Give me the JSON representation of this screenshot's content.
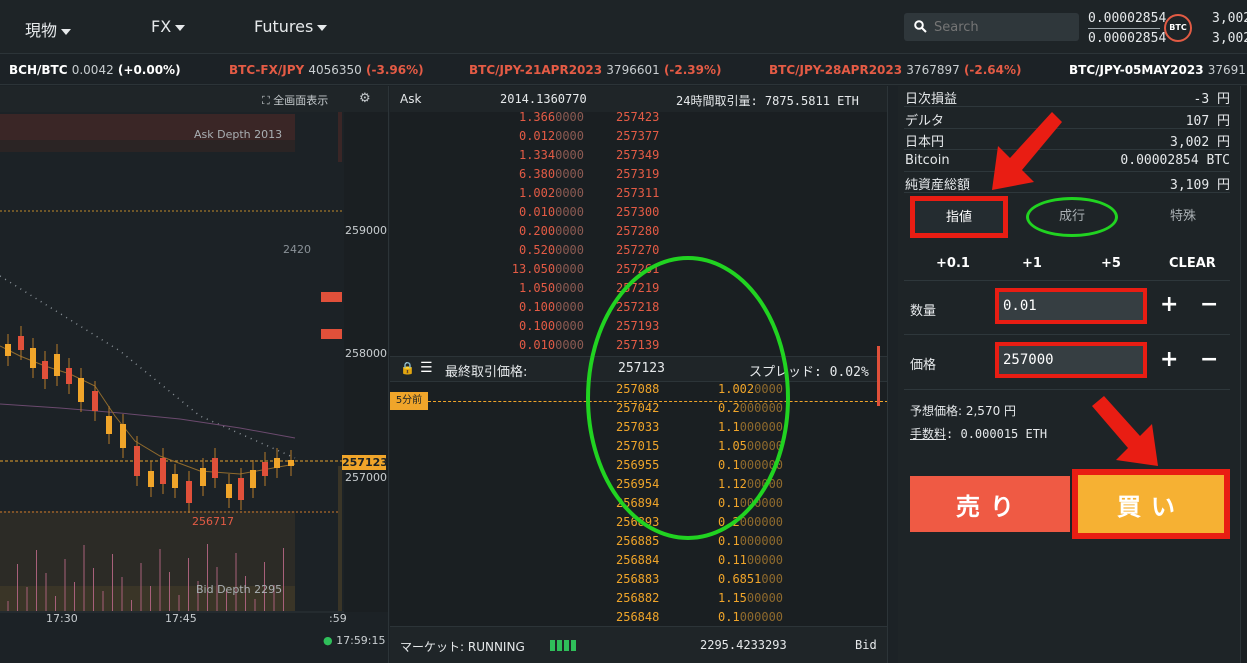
{
  "nav": {
    "items": [
      "現物",
      "FX",
      "Futures"
    ],
    "search_placeholder": "Search",
    "balance_top": "0.00002854",
    "balance_bottom": "0.00002854",
    "badge": "BTC",
    "right_top": "3,002",
    "right_bottom": "3,002"
  },
  "ticker": [
    {
      "symbol": "BCH/BTC",
      "price": "0.0042",
      "change": "(+0.00%)",
      "symbol_color": "white"
    },
    {
      "symbol": "BTC-FX/JPY",
      "price": "4056350",
      "change": "(-3.96%)",
      "symbol_color": "red"
    },
    {
      "symbol": "BTC/JPY-21APR2023",
      "price": "3796601",
      "change": "(-2.39%)",
      "symbol_color": "red"
    },
    {
      "symbol": "BTC/JPY-28APR2023",
      "price": "3767897",
      "change": "(-2.64%)",
      "symbol_color": "red"
    },
    {
      "symbol": "BTC/JPY-05MAY2023",
      "price": "37691",
      "change": "",
      "symbol_color": "white"
    }
  ],
  "chart": {
    "fullscreen_label": "全画面表示",
    "ask_depth_label": "Ask Depth 2013",
    "bid_depth_label": "Bid Depth 2295",
    "y_ticks": [
      "259000",
      "258000",
      "257000"
    ],
    "current_price": "257123",
    "low_label": "256717",
    "mid_label": "2420",
    "x_ticks": [
      "17:30",
      "17:45",
      ":59"
    ],
    "clock": "17:59:15"
  },
  "book": {
    "ask_label": "Ask",
    "ask_total": "2014.1360770",
    "volume_label": "24時間取引量: 7875.5811 ETH",
    "asks": [
      {
        "size_main": "1.366",
        "size_dim": "0000",
        "price": "257423"
      },
      {
        "size_main": "0.012",
        "size_dim": "0000",
        "price": "257377"
      },
      {
        "size_main": "1.334",
        "size_dim": "0000",
        "price": "257349"
      },
      {
        "size_main": "6.380",
        "size_dim": "0000",
        "price": "257319"
      },
      {
        "size_main": "1.002",
        "size_dim": "0000",
        "price": "257311"
      },
      {
        "size_main": "0.010",
        "size_dim": "0000",
        "price": "257300"
      },
      {
        "size_main": "0.200",
        "size_dim": "0000",
        "price": "257280"
      },
      {
        "size_main": "0.520",
        "size_dim": "0000",
        "price": "257270"
      },
      {
        "size_main": "13.050",
        "size_dim": "0000",
        "price": "257261"
      },
      {
        "size_main": "1.050",
        "size_dim": "0000",
        "price": "257219"
      },
      {
        "size_main": "0.100",
        "size_dim": "0000",
        "price": "257218"
      },
      {
        "size_main": "0.100",
        "size_dim": "0000",
        "price": "257193"
      },
      {
        "size_main": "0.010",
        "size_dim": "0000",
        "price": "257139"
      }
    ],
    "last_price_label": "最終取引価格:",
    "last_price": "257123",
    "spread_label": "スプレッド: 0.02%",
    "time_tag": "5分前",
    "bids": [
      {
        "price": "257088",
        "size_main": "1.002",
        "size_dim": "0000"
      },
      {
        "price": "257042",
        "size_main": "0.2",
        "size_dim": "000000"
      },
      {
        "price": "257033",
        "size_main": "1.1",
        "size_dim": "000000"
      },
      {
        "price": "257015",
        "size_main": "1.05",
        "size_dim": "00000"
      },
      {
        "price": "256955",
        "size_main": "0.1",
        "size_dim": "000000"
      },
      {
        "price": "256954",
        "size_main": "1.12",
        "size_dim": "00000"
      },
      {
        "price": "256894",
        "size_main": "0.1",
        "size_dim": "000000"
      },
      {
        "price": "256893",
        "size_main": "0.2",
        "size_dim": "000000"
      },
      {
        "price": "256885",
        "size_main": "0.1",
        "size_dim": "000000"
      },
      {
        "price": "256884",
        "size_main": "0.11",
        "size_dim": "00000"
      },
      {
        "price": "256883",
        "size_main": "0.6851",
        "size_dim": "000"
      },
      {
        "price": "256882",
        "size_main": "1.15",
        "size_dim": "00000"
      },
      {
        "price": "256848",
        "size_main": "0.1",
        "size_dim": "000000"
      }
    ],
    "market_label": "マーケット: RUNNING",
    "bid_total": "2295.4233293",
    "bid_label": "Bid"
  },
  "account": [
    {
      "label": "日次損益",
      "value": "-3 円"
    },
    {
      "label": "デルタ",
      "value": "107 円"
    },
    {
      "label": "日本円",
      "value": "3,002 円"
    },
    {
      "label": "Bitcoin",
      "value": "0.00002854 BTC"
    },
    {
      "label": "純資産総額",
      "value": "3,109 円"
    }
  ],
  "order": {
    "tabs": [
      "指値",
      "成行",
      "特殊"
    ],
    "quick": [
      "+0.1",
      "+1",
      "+5",
      "CLEAR"
    ],
    "qty_label": "数量",
    "qty_value": "0.01",
    "price_label": "価格",
    "price_value": "257000",
    "plus": "+",
    "minus": "−",
    "est_label": "予想価格: 2,570 円",
    "fee_label": "手数料",
    "fee_value": ": 0.000015 ETH",
    "sell": "売り",
    "buy": "買い"
  },
  "colors": {
    "ask": "#e45b45",
    "bid": "#f0a52a",
    "sell_button": "#ef5a44",
    "buy_button": "#f6b133",
    "highlight_red": "#e91d13",
    "highlight_green": "#21d321"
  }
}
